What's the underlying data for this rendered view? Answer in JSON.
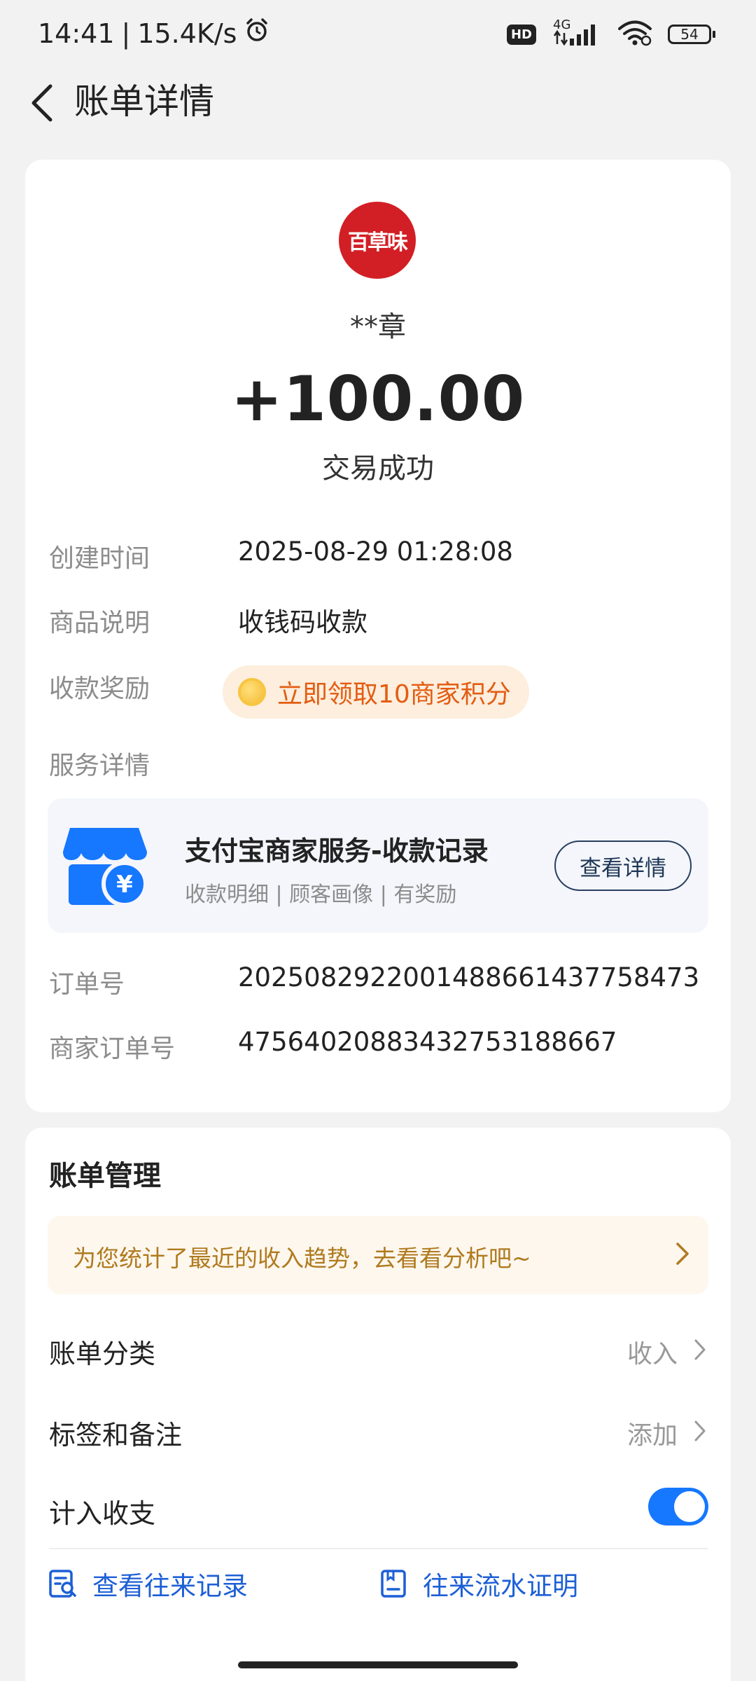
{
  "status_bar": {
    "time": "14:41",
    "speed": "15.4K/s",
    "hd": "HD",
    "network": "4G",
    "battery": "54"
  },
  "header": {
    "title": "账单详情"
  },
  "transaction": {
    "logo_text": "百草味",
    "payer": "**章",
    "amount": "+100.00",
    "status": "交易成功"
  },
  "details": {
    "created_label": "创建时间",
    "created_value": "2025-08-29 01:28:08",
    "desc_label": "商品说明",
    "desc_value": "收钱码收款",
    "reward_label": "收款奖励",
    "reward_value": "立即领取10商家积分",
    "service_label": "服务详情",
    "order_label": "订单号",
    "order_value": "2025082922001488661437758473",
    "merchant_order_label": "商家订单号",
    "merchant_order_value": "47564020883432753188667"
  },
  "service": {
    "title": "支付宝商家服务-收款记录",
    "subtitle": "收款明细 | 顾客画像 | 有奖励",
    "button": "查看详情"
  },
  "manage": {
    "title": "账单管理",
    "banner": "为您统计了最近的收入趋势，去看看分析吧~",
    "category_label": "账单分类",
    "category_value": "收入",
    "tags_label": "标签和备注",
    "tags_value": "添加",
    "include_label": "计入收支",
    "include_on": true,
    "link_records": "查看往来记录",
    "link_proof": "往来流水证明"
  },
  "colors": {
    "accent": "#1677ff",
    "reward_text": "#e35d12",
    "reward_bg": "#fdeede",
    "banner_text": "#b07a1e",
    "logo_red": "#d21f25"
  }
}
